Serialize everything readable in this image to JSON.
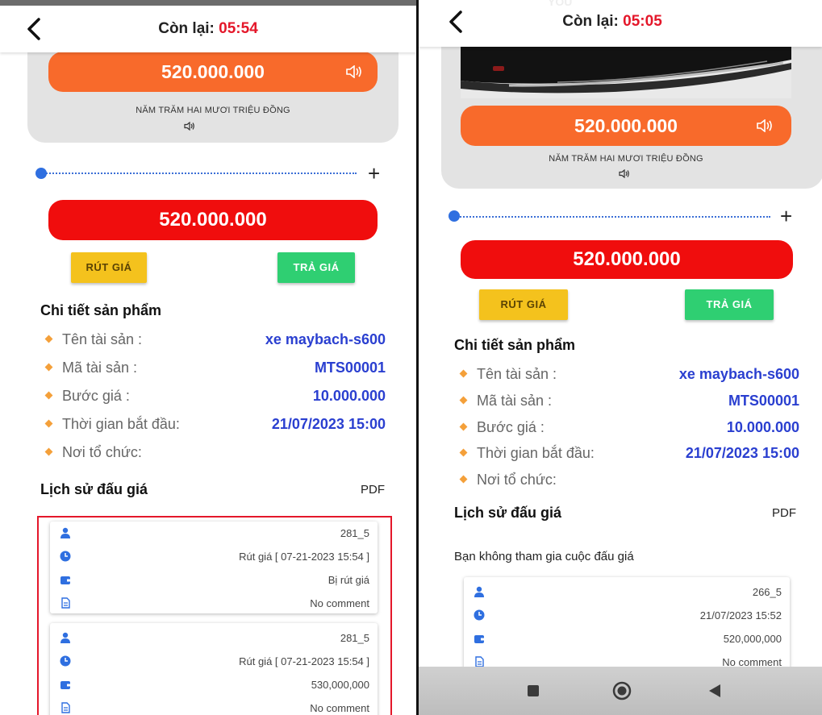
{
  "left": {
    "timer_label": "Còn lại:",
    "timer_value": "05:54",
    "price": "520.000.000",
    "price_words": "NĂM TRĂM HAI MƯƠI TRIỆU ĐỒNG",
    "bid_amount": "520.000.000",
    "withdraw_label": "RÚT GIÁ",
    "bid_label": "TRẢ GIÁ",
    "details_title": "Chi tiết sản phẩm",
    "details": [
      {
        "label": "Tên tài sản :",
        "value": "xe maybach-s600"
      },
      {
        "label": "Mã tài sản :",
        "value": "MTS00001"
      },
      {
        "label": "Bước giá :",
        "value": "10.000.000"
      },
      {
        "label": "Thời gian bắt đầu:",
        "value": "21/07/2023 15:00"
      },
      {
        "label": "Nơi tổ chức:",
        "value": ""
      }
    ],
    "history_title": "Lịch sử đấu giá",
    "pdf_label": "PDF",
    "history": [
      {
        "user": "281_5",
        "time": "Rút giá [ 07-21-2023 15:54 ]",
        "amount": "Bị rút giá",
        "comment": "No comment"
      },
      {
        "user": "281_5",
        "time": "Rút giá [ 07-21-2023 15:54 ]",
        "amount": "530,000,000",
        "comment": "No comment"
      }
    ]
  },
  "right": {
    "overlay_text": "YOU",
    "timer_label": "Còn lại:",
    "timer_value": "05:05",
    "price": "520.000.000",
    "price_words": "NĂM TRĂM HAI MƯƠI TRIỆU ĐỒNG",
    "bid_amount": "520.000.000",
    "withdraw_label": "RÚT GIÁ",
    "bid_label": "TRẢ GIÁ",
    "details_title": "Chi tiết sản phẩm",
    "details": [
      {
        "label": "Tên tài sản :",
        "value": "xe maybach-s600"
      },
      {
        "label": "Mã tài sản :",
        "value": "MTS00001"
      },
      {
        "label": "Bước giá :",
        "value": "10.000.000"
      },
      {
        "label": "Thời gian bắt đầu:",
        "value": "21/07/2023 15:00"
      },
      {
        "label": "Nơi tổ chức:",
        "value": ""
      }
    ],
    "history_title": "Lịch sử đấu giá",
    "pdf_label": "PDF",
    "no_participation": "Bạn không tham gia cuộc đấu giá",
    "history": [
      {
        "user": "266_5",
        "time": "21/07/2023 15:52",
        "amount": "520,000,000",
        "comment": "No comment"
      }
    ]
  },
  "colors": {
    "accent_orange": "#f86a2b",
    "bid_red": "#f00d0d",
    "timer_red": "#e4172a",
    "withdraw_yellow": "#f4c21d",
    "bid_green": "#2fcf72",
    "value_blue": "#2a3fd0"
  },
  "icons": {
    "back": "chevron-left-icon",
    "speaker": "speaker-icon",
    "user": "user-icon",
    "clock": "clock-icon",
    "wallet": "wallet-icon",
    "document": "document-icon",
    "nav_square": "recent-apps-icon",
    "nav_circle": "home-icon",
    "nav_triangle": "back-nav-icon"
  }
}
